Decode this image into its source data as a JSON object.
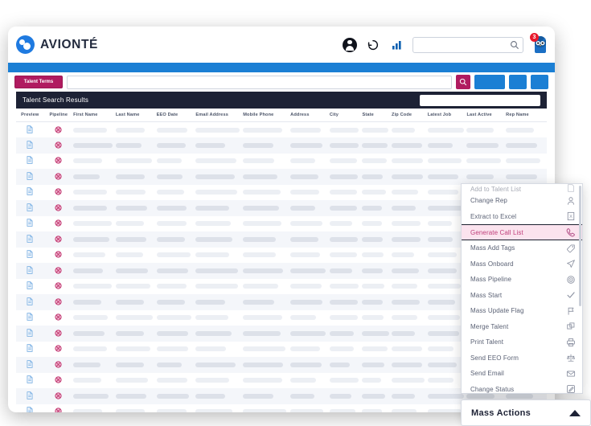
{
  "brand": {
    "name": "AVIONTÉ",
    "logo_icon": "avionte-logo-icon",
    "primary_blue": "#1b7fd4",
    "accent_magenta": "#b01b60",
    "dark_navy": "#1d2235"
  },
  "topbar": {
    "icons": [
      {
        "name": "user-account-icon",
        "glyph": "avatar"
      },
      {
        "name": "history-icon",
        "glyph": "history"
      },
      {
        "name": "analytics-icon",
        "glyph": "bars"
      }
    ],
    "global_search": {
      "placeholder": "",
      "value": "",
      "icon": "search-icon"
    },
    "notifications": {
      "icon": "owl-mascot-icon",
      "badge_count": "3"
    }
  },
  "search_toolbar": {
    "talent_terms_label": "Talent Terms",
    "terms_input": {
      "value": "",
      "placeholder": ""
    },
    "search_button_icon": "search-icon",
    "action_buttons": [
      {
        "name": "toolbar-action-1",
        "label": ""
      },
      {
        "name": "toolbar-action-2",
        "label": ""
      },
      {
        "name": "toolbar-action-3",
        "label": ""
      }
    ]
  },
  "results": {
    "title": "Talent Search Results",
    "filter_input": {
      "value": "",
      "placeholder": ""
    }
  },
  "table": {
    "columns": [
      {
        "key": "preview",
        "label": "Preview"
      },
      {
        "key": "pipeline",
        "label": "Pipeline"
      },
      {
        "key": "first",
        "label": "First Name"
      },
      {
        "key": "last",
        "label": "Last Name"
      },
      {
        "key": "eeo",
        "label": "EEO Date"
      },
      {
        "key": "email",
        "label": "Email Address"
      },
      {
        "key": "mobile",
        "label": "Mobile Phone"
      },
      {
        "key": "address",
        "label": "Address"
      },
      {
        "key": "city",
        "label": "City"
      },
      {
        "key": "state",
        "label": "State"
      },
      {
        "key": "zip",
        "label": "Zip Code"
      },
      {
        "key": "latest",
        "label": "Latest Job"
      },
      {
        "key": "lastact",
        "label": "Last Active"
      },
      {
        "key": "rep",
        "label": "Rep Name"
      }
    ],
    "row_count": 19,
    "preview_icon": "document-preview-icon",
    "pipeline_icon": "pipeline-blocked-icon",
    "cells_redacted": true
  },
  "mass_actions_menu": {
    "partial_top_item": "Add to Talent List",
    "items": [
      {
        "label": "Change Rep",
        "icon": "person-icon",
        "selected": false
      },
      {
        "label": "Extract to Excel",
        "icon": "excel-file-icon",
        "selected": false
      },
      {
        "label": "Generate Call List",
        "icon": "phone-icon",
        "selected": true
      },
      {
        "label": "Mass Add Tags",
        "icon": "tag-icon",
        "selected": false
      },
      {
        "label": "Mass Onboard",
        "icon": "paper-plane-icon",
        "selected": false
      },
      {
        "label": "Mass Pipeline",
        "icon": "target-icon",
        "selected": false
      },
      {
        "label": "Mass Start",
        "icon": "check-icon",
        "selected": false
      },
      {
        "label": "Mass Update Flag",
        "icon": "flag-icon",
        "selected": false
      },
      {
        "label": "Merge Talent",
        "icon": "merge-copy-icon",
        "selected": false
      },
      {
        "label": "Print Talent",
        "icon": "printer-icon",
        "selected": false
      },
      {
        "label": "Send EEO Form",
        "icon": "scales-icon",
        "selected": false
      },
      {
        "label": "Send Email",
        "icon": "envelope-icon",
        "selected": false
      },
      {
        "label": "Change Status",
        "icon": "edit-square-icon",
        "selected": false
      }
    ]
  },
  "mass_actions_footer": {
    "label": "Mass  Actions",
    "caret_icon": "chevron-up-icon",
    "expanded": true
  }
}
